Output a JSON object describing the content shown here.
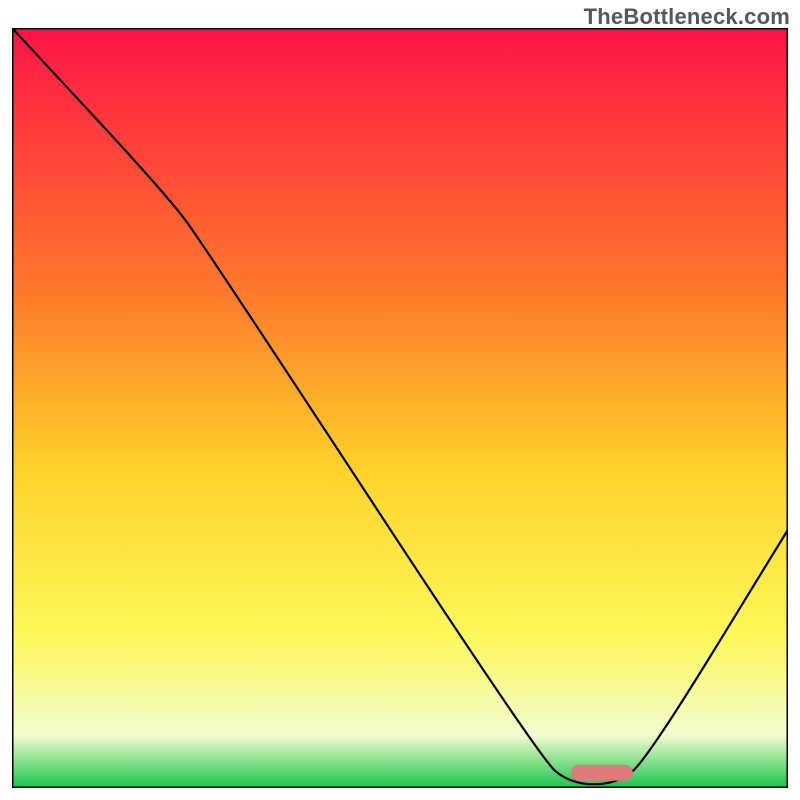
{
  "watermark": "TheBottleneck.com",
  "colors": {
    "grad_top": "#ff1446",
    "grad_mid1": "#ff7a2b",
    "grad_mid2": "#ffd22a",
    "grad_mid3": "#fdf85a",
    "grad_mid4": "#f3fccf",
    "grad_bottom": "#17c54b",
    "curve": "#000000",
    "marker_fill": "#e07a7a",
    "frame": "#000000"
  },
  "chart_data": {
    "type": "line",
    "title": "",
    "xlabel": "",
    "ylabel": "",
    "xlim": [
      0,
      100
    ],
    "ylim": [
      0,
      100
    ],
    "grid": false,
    "curve": [
      {
        "x": 0,
        "y": 100
      },
      {
        "x": 20,
        "y": 78
      },
      {
        "x": 25,
        "y": 71
      },
      {
        "x": 68,
        "y": 4
      },
      {
        "x": 72,
        "y": 0.5
      },
      {
        "x": 78,
        "y": 0.5
      },
      {
        "x": 82,
        "y": 4
      },
      {
        "x": 100,
        "y": 34
      }
    ],
    "marker": {
      "x_start": 72,
      "x_end": 80,
      "y": 2.0,
      "rx": 1.5
    }
  }
}
